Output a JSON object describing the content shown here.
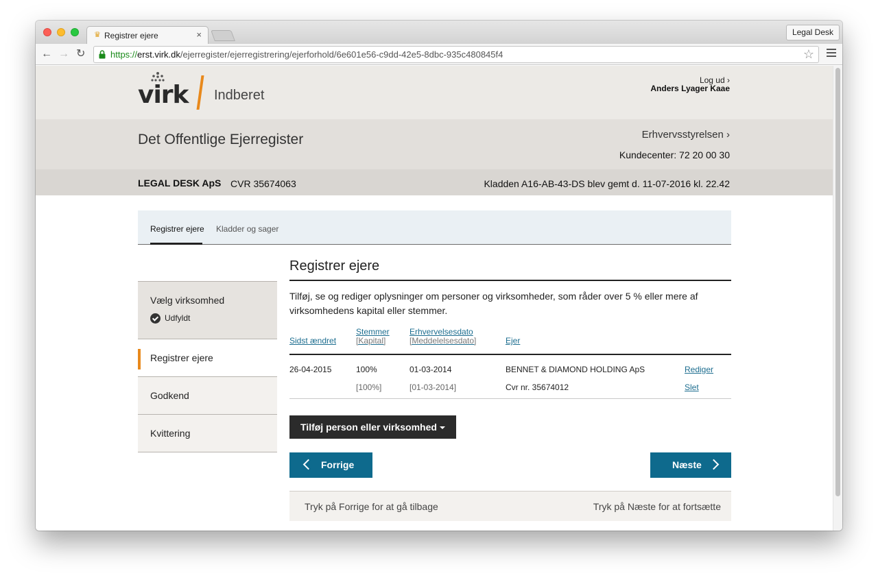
{
  "browser": {
    "tab_title": "Registrer ejere",
    "tab_close": "×",
    "profile": "Legal Desk",
    "url_scheme": "https://",
    "url_host": "erst.virk.dk",
    "url_path": "/ejerregister/ejerregistrering/ejerforhold/6e601e56-c9dd-42e5-8dbc-935c480845f4"
  },
  "header": {
    "logo_text": "virk",
    "logo_sub": "Indberet",
    "logout": "Log ud ›",
    "user": "Anders Lyager Kaae",
    "site_title": "Det Offentlige Ejerregister",
    "agency": "Erhvervsstyrelsen ›",
    "customer_center": "Kundecenter: 72 20 00 30",
    "company": "LEGAL DESK ApS",
    "cvr": "CVR 35674063",
    "draft_status": "Kladden A16-AB-43-DS blev gemt d. 11-07-2016 kl. 22.42"
  },
  "tabs": [
    "Registrer ejere",
    "Kladder og sager"
  ],
  "sidebar": {
    "items": [
      "Vælg virksomhed",
      "Registrer ejere",
      "Godkend",
      "Kvittering"
    ],
    "done_label": "Udfyldt"
  },
  "main": {
    "title": "Registrer ejere",
    "intro": "Tilføj, se og rediger oplysninger om personer og virksomheder, som råder over 5 % eller mere af virksomhedens kapital eller stemmer.",
    "columns": {
      "changed": "Sidst ændret",
      "votes": "Stemmer",
      "capital": "[Kapital]",
      "acq_date": "Erhvervelsesdato",
      "notice_date": "[Meddelelsesdato]",
      "owner": "Ejer"
    },
    "rows": [
      {
        "changed": "26-04-2015",
        "votes": "100%",
        "capital": "[100%]",
        "acq_date": "01-03-2014",
        "notice_date": "[01-03-2014]",
        "owner": "BENNET & DIAMOND HOLDING ApS",
        "owner_cvr": "Cvr nr. 35674012",
        "edit": "Rediger",
        "delete": "Slet"
      }
    ],
    "add_button": "Tilføj person eller virksomhed",
    "prev_button": "Forrige",
    "next_button": "Næste",
    "hint_prev": "Tryk på Forrige for at gå tilbage",
    "hint_next": "Tryk på Næste for at fortsætte"
  }
}
